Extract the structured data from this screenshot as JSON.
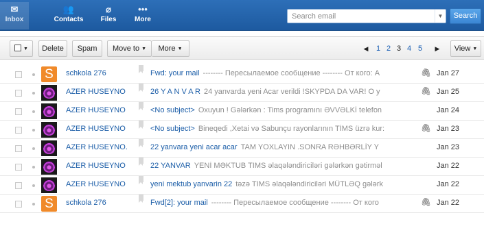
{
  "nav": {
    "inbox": "Inbox",
    "contacts": "Contacts",
    "files": "Files",
    "more": "More"
  },
  "search": {
    "placeholder": "Search email",
    "button": "Search"
  },
  "toolbar": {
    "delete": "Delete",
    "spam": "Spam",
    "move_to": "Move to",
    "more": "More",
    "view": "View",
    "pages": [
      "1",
      "2",
      "3",
      "4",
      "5"
    ],
    "current_page": "3"
  },
  "messages": [
    {
      "sender": "schkola 276",
      "avatar": "S",
      "subject": "Fwd: your mail",
      "preview": "-------- Пересылаемое сообщение -------- От кого: А",
      "attachment": true,
      "date": "Jan 27"
    },
    {
      "sender": "AZER HUSEYNO",
      "avatar": "",
      "subject": "26 Y A N V A R",
      "preview": "24 yanvarda yeni Acar verildi !SKYPDA DA VAR! O y",
      "attachment": true,
      "date": "Jan 25"
    },
    {
      "sender": "AZER HUSEYNO",
      "avatar": "",
      "subject": "<No subject>",
      "preview": "Oxuyun ! Gələrkən : Tims programını ƏVVƏLKİ telefon",
      "attachment": false,
      "date": "Jan 24"
    },
    {
      "sender": "AZER HUSEYNO",
      "avatar": "",
      "subject": "<No subject>",
      "preview": "Bineqedi ,Xetai və Sabunçu rayonlarının TİMS üzrə kur:",
      "attachment": true,
      "date": "Jan 23"
    },
    {
      "sender": "AZER HUSEYNO.",
      "avatar": "",
      "subject": "22 yanvara yeni acar acar",
      "preview": "TAM YOXLAYIN .SONRA RƏHBƏRLİY Y",
      "attachment": false,
      "date": "Jan 23"
    },
    {
      "sender": "AZER HUSEYNO",
      "avatar": "",
      "subject": "22 YANVAR",
      "preview": "YENİ MƏKTUB TIMS əlaqələndiriciləri gələrkən gətirməl",
      "attachment": false,
      "date": "Jan 22"
    },
    {
      "sender": "AZER HUSEYNO",
      "avatar": "",
      "subject": "yeni mektub yanvarin 22",
      "preview": "təzə TIMS əlaqələndiriciləri MÜTLƏQ gələrk",
      "attachment": false,
      "date": "Jan 22"
    },
    {
      "sender": "schkola 276",
      "avatar": "S",
      "subject": "Fwd[2]: your mail",
      "preview": "-------- Пересылаемое сообщение -------- От кого",
      "attachment": true,
      "date": "Jan 22"
    }
  ]
}
